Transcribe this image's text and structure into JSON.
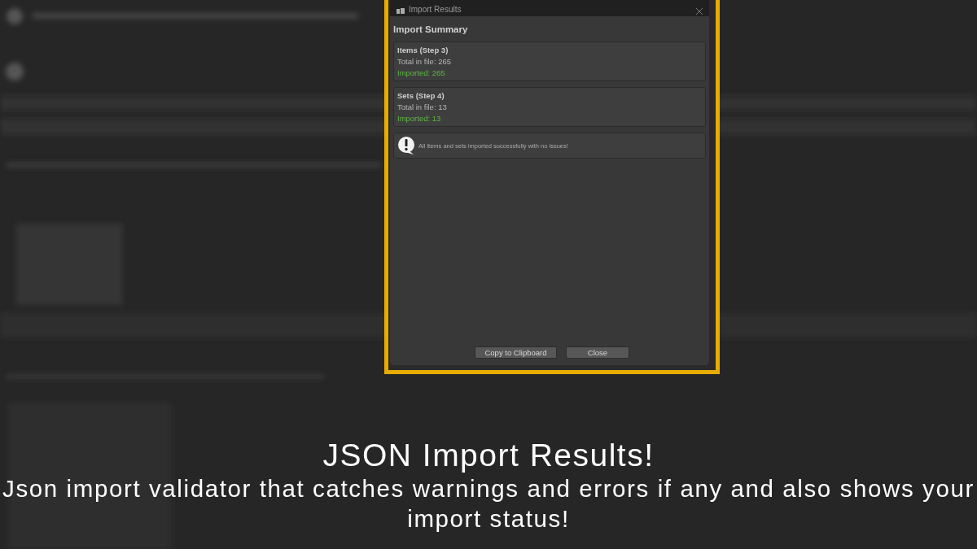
{
  "dialog": {
    "title": "Import Results",
    "heading": "Import Summary",
    "sections": [
      {
        "title": "Items (Step 3)",
        "total": "Total in file: 265",
        "imported": "Imported: 265"
      },
      {
        "title": "Sets (Step 4)",
        "total": "Total in file: 13",
        "imported": "Imported: 13"
      }
    ],
    "message": "All items and sets imported successfully with no issues!",
    "buttons": [
      "Copy to Clipboard",
      "Close"
    ]
  },
  "caption": {
    "title": "JSON Import Results!",
    "text": "Json import validator that catches warnings and errors if any and also shows your import status!"
  }
}
